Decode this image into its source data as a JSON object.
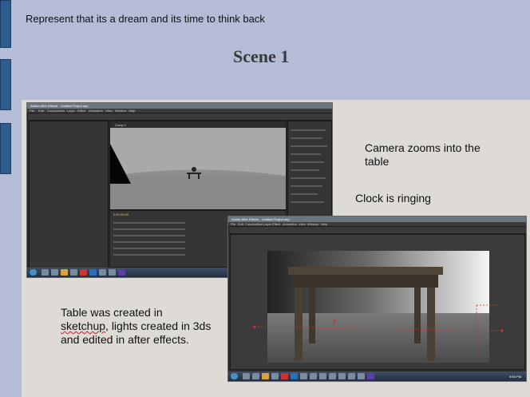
{
  "header": {
    "instruction": "Represent that its a dream and its time to think back",
    "title": "Scene 1"
  },
  "notes": {
    "camera": "Camera zooms into the table",
    "clock": "Clock is ringing",
    "table_word1": "Table was created in",
    "table_word2": "sketchup",
    "table_rest": ", lights created in 3ds and edited in after effects."
  },
  "screenshot1": {
    "window_title": "Adobe After Effects - Untitled Project.aep",
    "menus": [
      "File",
      "Edit",
      "Composition",
      "Layer",
      "Effect",
      "Animation",
      "View",
      "Window",
      "Help"
    ],
    "comp_tab": "Comp 1",
    "timecode": "0:00:00:00"
  },
  "screenshot2": {
    "window_title": "Adobe After Effects - Untitled Project.aep",
    "menus": [
      "File",
      "Edit",
      "Composition",
      "Layer",
      "Effect",
      "Animation",
      "View",
      "Window",
      "Help"
    ],
    "clock": "9:55 PM"
  },
  "colors": {
    "background": "#b4bcd6",
    "content_area": "#dedbd6",
    "tab_blue": "#2d5c8e"
  }
}
